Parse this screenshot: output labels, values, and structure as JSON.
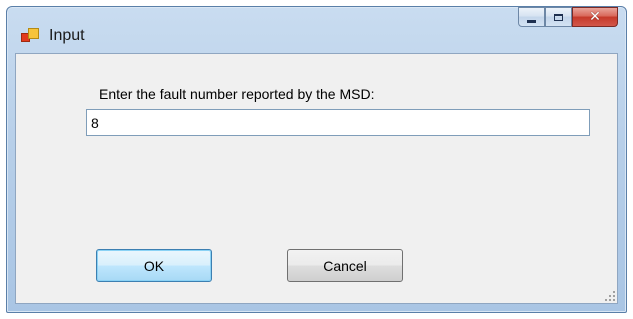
{
  "window": {
    "title": "Input",
    "icon": "app-icon",
    "controls": [
      "minimize-icon",
      "maximize-icon",
      "close-icon"
    ]
  },
  "dialog": {
    "prompt": "Enter the fault number reported by the MSD:",
    "input_value": "8",
    "ok_label": "OK",
    "cancel_label": "Cancel"
  },
  "colors": {
    "titlebar": "#b7cfe9",
    "client_bg": "#f0f0f0",
    "close_button": "#c5392a",
    "default_button_border": "#3c7fb1"
  }
}
